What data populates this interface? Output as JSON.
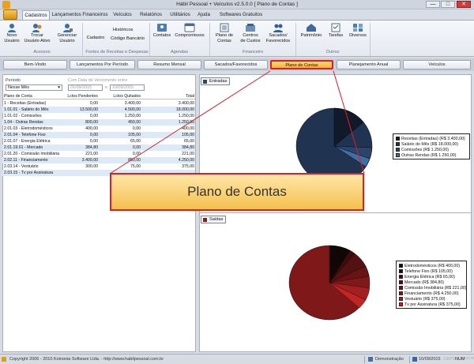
{
  "window": {
    "title": "Hábil Pessoal + Veículos v2.5.0.0 [ Plano de Contas ]",
    "controls": [
      "—",
      "□",
      "✕"
    ]
  },
  "ribbon_tabs": [
    "Cadastros",
    "Lançamentos Financeiros",
    "Veículos",
    "Relatórios",
    "Utilitários",
    "Ajuda",
    "Softwares Gratuitos"
  ],
  "ribbon": {
    "groups": [
      {
        "label": "Acessos"
      },
      {
        "label": "Fontes de Receitas e Despesas"
      },
      {
        "label": "Agendas"
      },
      {
        "label": "Financeiro"
      },
      {
        "label": "Outros"
      }
    ],
    "buttons": [
      {
        "label": "Novo\nUsuário"
      },
      {
        "label": "Trocar\nUsuário Ativo"
      },
      {
        "label": "Gerenciar\nUsuário"
      },
      {
        "label": "Cadastro"
      },
      {
        "label": "Contatos"
      },
      {
        "label": "Compromissos"
      },
      {
        "label": "Plano de\nContas"
      },
      {
        "label": "Centros\nde Custos"
      },
      {
        "label": "Sacados/\nFavorecidos"
      },
      {
        "label": "Patrimônio"
      },
      {
        "label": "Tarefas"
      },
      {
        "label": "Diversos"
      }
    ],
    "small_items": {
      "historicos": "Históricos",
      "codigo": "Código Bancário"
    }
  },
  "nav_buttons": [
    "Bem-Vindo",
    "Lançamentos Por Período",
    "Resumo Mensal",
    "Sacados/Favorecidos",
    "Plano de Contas",
    "Planejamento Anual",
    "Veículos"
  ],
  "filters": {
    "periodo_label": "Período",
    "periodo_value": "Nesse Mês",
    "data_label": "Com Data de Vencimento entre",
    "date_from": "01/09/2015",
    "date_to": "10/09/2015",
    "sep": "e"
  },
  "table": {
    "headers": [
      "Plano de Conta",
      "Lctos Pendentes",
      "Lctos Quitados",
      "Total"
    ],
    "rows": [
      [
        "1 - Receitas (Entradas)",
        "0,00",
        "3.400,00",
        "3.400,00"
      ],
      [
        "1.01.01 - Salário do Mês",
        "13.500,00",
        "4.500,00",
        "18.000,00"
      ],
      [
        "1.01.02 - Comissões",
        "0,00",
        "1.250,00",
        "1.250,00"
      ],
      [
        "1.04 - Outras Rendas",
        "800,00",
        "450,00",
        "1.250,00"
      ],
      [
        "2.01.03 - Eletrodomésticos",
        "400,00",
        "0,00",
        "400,00"
      ],
      [
        "2.01.04 - Telefone Fixo",
        "0,00",
        "105,00",
        "105,00"
      ],
      [
        "2.01.07 - Energia Elétrica",
        "0,00",
        "65,00",
        "65,00"
      ],
      [
        "2.01.19.01 - Mercado",
        "384,80",
        "0,00",
        "384,80"
      ],
      [
        "2.01.20 - Comissão Imobiliária",
        "221,00",
        "0,00",
        "221,00"
      ],
      [
        "2.02.11 - Financiamento",
        "3.400,00",
        "850,00",
        "4.250,00"
      ],
      [
        "2.03.14 - Vestuário",
        "300,00",
        "75,00",
        "375,00"
      ],
      [
        "2.03.15 - Tv por Assinatura",
        "",
        "",
        ""
      ]
    ]
  },
  "charts": {
    "entradas_title": "Entradas",
    "saidas_title": "Saídas",
    "entradas_color": "#2f4769",
    "saidas_color": "#8c1a1a",
    "entradas_legend": [
      {
        "label": "Receitas (Entradas) (R$ 3.400,00)",
        "color": "#111a2b"
      },
      {
        "label": "Salário do Mês (R$ 18.000,00)",
        "color": "#203452"
      },
      {
        "label": "Comissões (R$ 1.250,00)",
        "color": "#2b446b"
      },
      {
        "label": "Outras Rendas (R$ 1.250,00)",
        "color": "#3e6ea3"
      }
    ],
    "saidas_legend": [
      {
        "label": "Eletrodomésticos (R$ 400,00)",
        "color": "#120707"
      },
      {
        "label": "Telefone Fixo (R$ 105,00)",
        "color": "#250a0a"
      },
      {
        "label": "Energia Elétrica (R$ 65,00)",
        "color": "#3b0d0d"
      },
      {
        "label": "Mercado (R$ 384,80)",
        "color": "#531111"
      },
      {
        "label": "Comissão Imobiliária (R$ 221,00)",
        "color": "#681414"
      },
      {
        "label": "Financiamento (R$ 4.250,00)",
        "color": "#7f1818"
      },
      {
        "label": "Vestuário (R$ 375,00)",
        "color": "#a32020"
      },
      {
        "label": "Tv por Assinatura (R$ 375,00)",
        "color": "#c12626"
      }
    ]
  },
  "callout": "Plano de Contas",
  "status": {
    "copyright": "Copyright 2006 - 2010 Koinonia Software Ltda. - http://www.habilpessoal.com.br",
    "mode": "Demonstração",
    "date": "10/09/2015",
    "caps": "CAPS",
    "num": "NUM",
    "scrl": "SCRL"
  }
}
